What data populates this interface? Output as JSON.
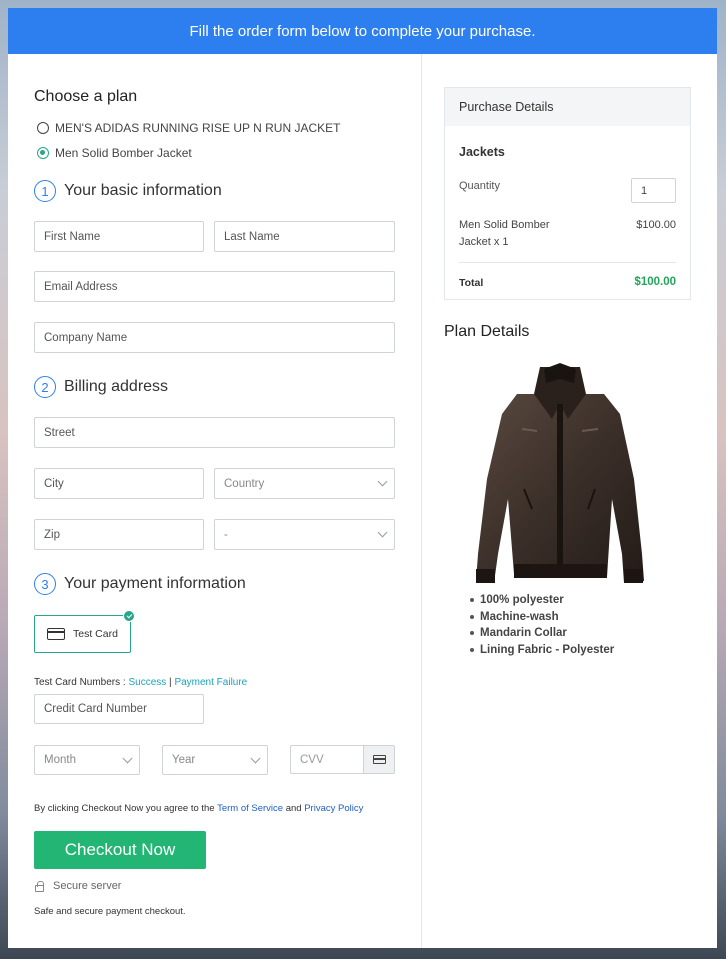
{
  "banner": {
    "text": "Fill the order form below to complete your purchase."
  },
  "plan": {
    "heading": "Choose a plan",
    "options": [
      {
        "label": "MEN'S ADIDAS RUNNING RISE UP N RUN JACKET",
        "selected": false
      },
      {
        "label": "Men Solid Bomber Jacket",
        "selected": true
      }
    ]
  },
  "basic_info": {
    "number": "1",
    "title": "Your basic information",
    "first_name_placeholder": "First Name",
    "last_name_placeholder": "Last Name",
    "email_placeholder": "Email Address",
    "company_placeholder": "Company Name"
  },
  "billing": {
    "number": "2",
    "title": "Billing address",
    "street_placeholder": "Street",
    "city_placeholder": "City",
    "country_selected": "Country",
    "zip_placeholder": "Zip",
    "state_selected": "-"
  },
  "payment": {
    "number": "3",
    "title": "Your payment information",
    "method_label": "Test Card",
    "test_numbers_prefix": "Test Card Numbers : ",
    "success_link": "Success",
    "separator": " | ",
    "failure_link": "Payment Failure",
    "card_number_placeholder": "Credit Card Number",
    "month_selected": "Month",
    "year_selected": "Year",
    "cvv_placeholder": "CVV"
  },
  "terms": {
    "prefix": "By clicking Checkout Now you agree to the ",
    "tos_link": "Term of Service",
    "and": " and ",
    "privacy_link": "Privacy Policy"
  },
  "checkout": {
    "button_label": "Checkout Now",
    "secure_label": "Secure server",
    "note": "Safe and secure payment checkout."
  },
  "purchase_details": {
    "header": "Purchase Details",
    "category": "Jackets",
    "quantity_label": "Quantity",
    "quantity_value": "1",
    "item_line1": "Men Solid Bomber",
    "item_line2": "Jacket x 1",
    "item_price": "$100.00",
    "total_label": "Total",
    "total_value": "$100.00"
  },
  "plan_details": {
    "title": "Plan Details",
    "features": [
      "100% polyester",
      "Machine-wash",
      "Mandarin Collar",
      "Lining Fabric - Polyester"
    ]
  },
  "colors": {
    "banner": "#2d7ff0",
    "accent_green": "#22b573",
    "teal": "#2aa58a",
    "link": "#1aa3b8"
  }
}
